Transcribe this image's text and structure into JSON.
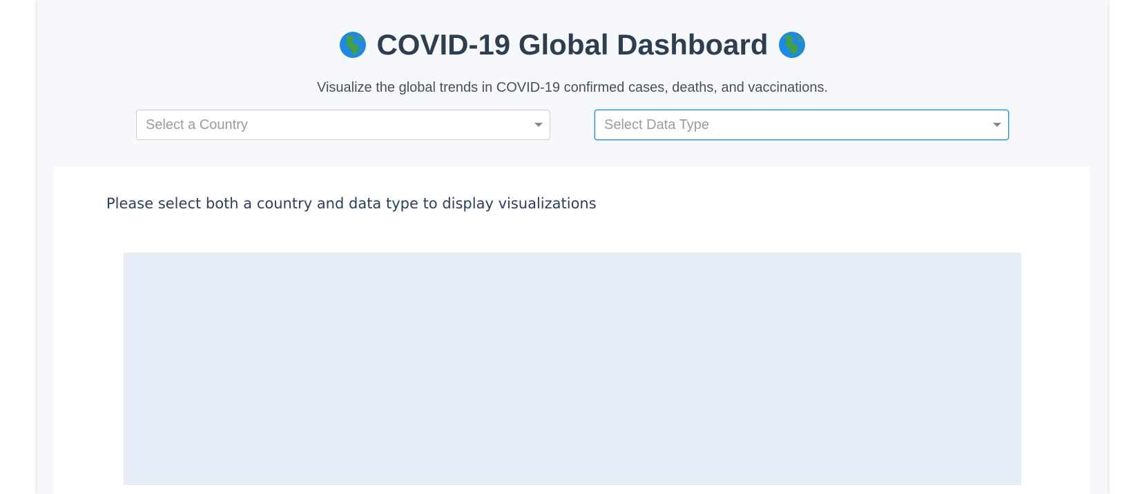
{
  "header": {
    "title": "COVID-19 Global Dashboard",
    "subtitle": "Visualize the global trends in COVID-19 confirmed cases, deaths, and vaccinations.",
    "title_icon": "globe-africa-icon"
  },
  "filters": {
    "country": {
      "placeholder": "Select a Country",
      "value": ""
    },
    "data_type": {
      "placeholder": "Select Data Type",
      "value": "",
      "focused": true
    }
  },
  "visualization": {
    "message": "Please select both a country and data type to display visualizations",
    "plot_background": "#e5ecf6"
  },
  "colors": {
    "title": "#2c3e50",
    "focus_border": "#1a8fe0",
    "page_background": "#f7f8fb"
  }
}
